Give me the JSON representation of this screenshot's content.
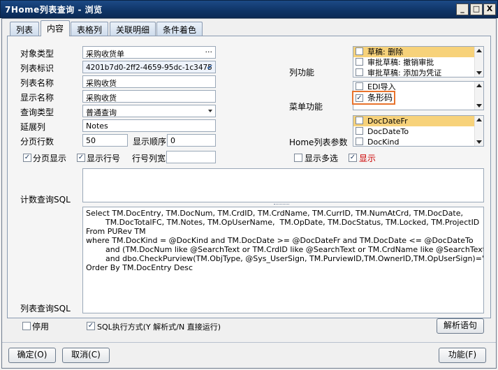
{
  "window": {
    "title": "7Home列表查询 - 浏览",
    "min": "_",
    "max": "□",
    "close": "X"
  },
  "tabs": [
    "列表",
    "内容",
    "表格列",
    "关联明细",
    "条件着色"
  ],
  "form": {
    "object_type_label": "对象类型",
    "object_type_value": "采购收货单",
    "object_type_btn": "···",
    "list_id_label": "列表标识",
    "list_id_value": "4201b7d0-2ff2-4659-95dc-1c3475",
    "list_id_check": "✔",
    "list_name_label": "列表名称",
    "list_name_value": "采购收货",
    "display_name_label": "显示名称",
    "display_name_value": "采购收货",
    "query_type_label": "查询类型",
    "query_type_value": "普通查询",
    "ext_col_label": "延展列",
    "ext_col_value": "Notes",
    "page_rows_label": "分页行数",
    "page_rows_value": "50",
    "display_order_label": "显示顺序",
    "display_order_value": "0",
    "paged_label": "分页显示",
    "show_rownum_label": "显示行号",
    "rownum_width_label": "行号列宽",
    "rownum_width_value": "",
    "multi_select_label": "显示多选",
    "show_label": "显示"
  },
  "col_func": {
    "label": "列功能",
    "items": [
      {
        "text": "草稿: 删除",
        "checked": false,
        "selected": true
      },
      {
        "text": "审批草稿: 撤销审批",
        "checked": false,
        "selected": false
      },
      {
        "text": "审批草稿: 添加为凭证",
        "checked": false,
        "selected": false
      }
    ]
  },
  "menu_func": {
    "label": "菜单功能",
    "items": [
      {
        "text": "EDI导入",
        "checked": false
      },
      {
        "text": "条形码",
        "checked": true
      }
    ]
  },
  "home_params": {
    "label": "Home列表参数",
    "items": [
      {
        "text": "DocDateFr",
        "checked": false,
        "selected": true
      },
      {
        "text": "DocDateTo",
        "checked": false,
        "selected": false
      },
      {
        "text": "DocKind",
        "checked": false,
        "selected": false
      }
    ]
  },
  "count_sql_label": "计数查询SQL",
  "list_sql_label": "列表查询SQL",
  "list_sql": "Select TM.DocEntry, TM.DocNum, TM.CrdID, TM.CrdName, TM.CurrID, TM.NumAtCrd, TM.DocDate,\n        TM.DocTotalFC, TM.Notes, TM.OpUserName,  TM.OpDate, TM.DocStatus, TM.Locked, TM.ProjectID\nFrom PURev TM\nwhere TM.DocKind = @DocKind and TM.DocDate >= @DocDateFr and TM.DocDate <= @DocDateTo\n        and (TM.DocNum like @SearchText or TM.CrdID like @SearchText or TM.CrdName like @SearchText)\n        and dbo.CheckPurview(TM.ObjType, @Sys_UserSign, TM.PurviewID,TM.OwnerID,TM.OpUserSign)='Y'\nOrder By TM.DocEntry Desc",
  "bottom": {
    "disable_label": "停用",
    "sql_mode_label": "SQL执行方式(Y 解析式/N 直接运行)",
    "parse_btn": "解析语句"
  },
  "footer": {
    "ok": "确定(O)",
    "cancel": "取消(C)",
    "func": "功能(F)"
  },
  "colors": {
    "accent_orange": "#e8732c",
    "selected": "#f7d27a",
    "red_text": "#cc0000"
  }
}
